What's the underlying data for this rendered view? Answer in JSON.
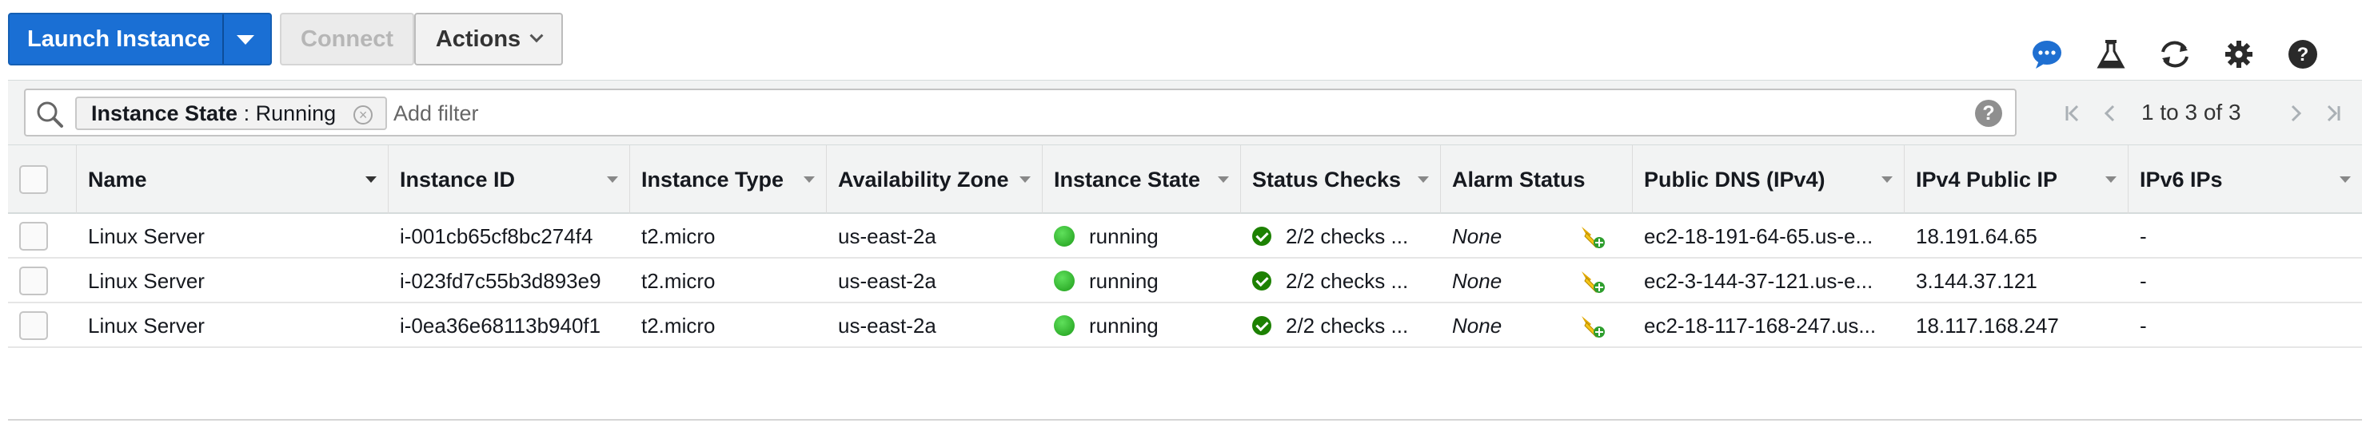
{
  "toolbar": {
    "launch_label": "Launch Instance",
    "connect_label": "Connect",
    "actions_label": "Actions",
    "icons": [
      "chat-icon",
      "flask-icon",
      "refresh-icon",
      "gear-icon",
      "help-icon"
    ]
  },
  "filter": {
    "token_key": "Instance State",
    "token_sep": " : ",
    "token_value": "Running",
    "placeholder": "Add filter",
    "help": "?"
  },
  "pager": {
    "text": "1 to 3 of 3"
  },
  "table": {
    "columns": [
      "Name",
      "Instance ID",
      "Instance Type",
      "Availability Zone",
      "Instance State",
      "Status Checks",
      "Alarm Status",
      "Public DNS (IPv4)",
      "IPv4 Public IP",
      "IPv6 IPs"
    ],
    "rows": [
      {
        "name": "Linux Server",
        "instance_id": "i-001cb65cf8bc274f4",
        "instance_type": "t2.micro",
        "zone": "us-east-2a",
        "state": "running",
        "status_checks": "2/2 checks ...",
        "alarm": "None",
        "public_dns": "ec2-18-191-64-65.us-e...",
        "public_ip": "18.191.64.65",
        "ipv6": "-"
      },
      {
        "name": "Linux Server",
        "instance_id": "i-023fd7c55b3d893e9",
        "instance_type": "t2.micro",
        "zone": "us-east-2a",
        "state": "running",
        "status_checks": "2/2 checks ...",
        "alarm": "None",
        "public_dns": "ec2-3-144-37-121.us-e...",
        "public_ip": "3.144.37.121",
        "ipv6": "-"
      },
      {
        "name": "Linux Server",
        "instance_id": "i-0ea36e68113b940f1",
        "instance_type": "t2.micro",
        "zone": "us-east-2a",
        "state": "running",
        "status_checks": "2/2 checks ...",
        "alarm": "None",
        "public_dns": "ec2-18-117-168-247.us...",
        "public_ip": "18.117.168.247",
        "ipv6": "-"
      }
    ]
  },
  "colors": {
    "primary": "#1a6fd4",
    "running": "#2db82a",
    "check_ok": "#1d8102",
    "chat_icon": "#1f6fd1"
  }
}
